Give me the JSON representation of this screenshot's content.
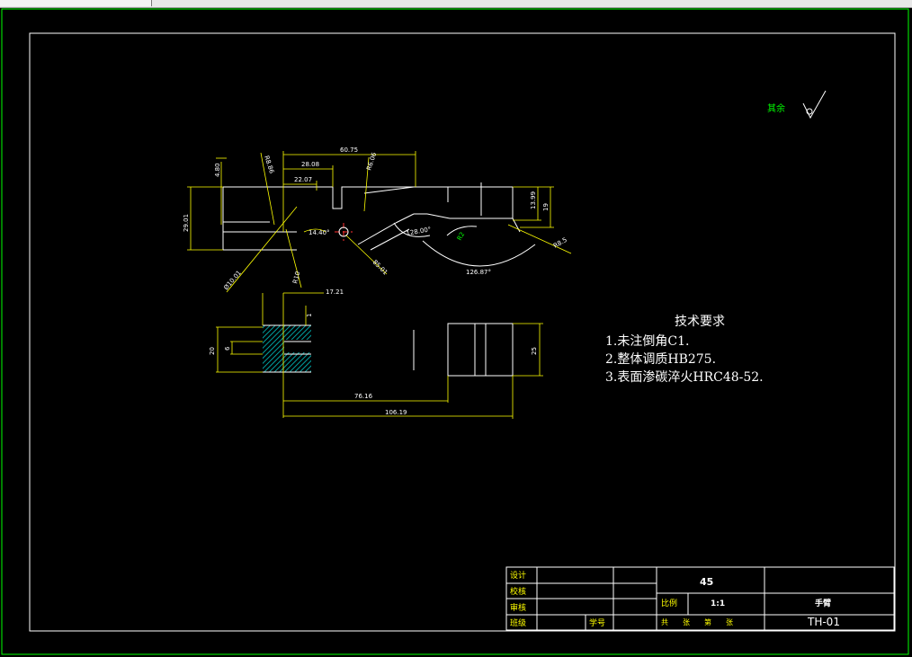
{
  "dimensions": {
    "d_60_75": "60.75",
    "d_28_08": "28.08",
    "d_22_07": "22.07",
    "d_4_80": "4.80",
    "d_29_01": "29.01",
    "d_13_99": "13.99",
    "d_19": "19",
    "d_r6_06": "R6.06",
    "d_r8_86": "R8.86",
    "d_14_40": "14.40°",
    "d_128_00": "128.00°",
    "d_126_87": "126.87°",
    "d_r8_5": "R8.5",
    "d_85_01": "85.01",
    "d_a10_01": "Ø10.01",
    "d_r10": "R10",
    "d_r2": "R2",
    "d_17_21": "17.21",
    "d_1": "1",
    "d_20": "20",
    "d_6": "6",
    "d_25": "25",
    "d_76_16": "76.16",
    "d_106_19": "106.19"
  },
  "surface_finish": {
    "label": "其余"
  },
  "tech_requirements": {
    "title": "技术要求",
    "items": [
      "1.未注倒角C1.",
      "2.整体调质HB275.",
      "3.表面渗碳淬火HRC48-52."
    ]
  },
  "title_block": {
    "design": "设计",
    "check": "校核",
    "review": "审核",
    "class": "班级",
    "student_no": "学号",
    "material": "45",
    "scale_label": "比例",
    "scale_value": "1:1",
    "part_name": "手臂",
    "sheets": "共　张　第　张",
    "drawing_no": "TH-01"
  },
  "colors": {
    "background": "#000000",
    "frame": "#00ff00",
    "part_outline": "#ffffff",
    "dimension": "#ffff00",
    "center_line": "#ff0000",
    "hatch": "#00c8c8"
  }
}
